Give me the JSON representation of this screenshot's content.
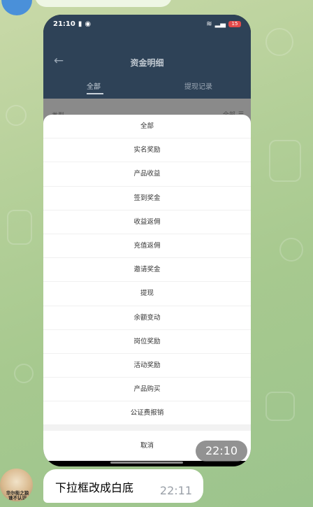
{
  "phone": {
    "status": {
      "time": "21:10",
      "battery": "15"
    },
    "header": {
      "title": "资金明细",
      "back_icon": "arrow-left-icon"
    },
    "tabs": [
      "全部",
      "提现记录"
    ],
    "filter": {
      "label": "类型",
      "value": "全部",
      "icon": "list-icon"
    },
    "options": [
      "全部",
      "实名奖励",
      "产品收益",
      "签到奖金",
      "收益返佣",
      "充值返佣",
      "邀请奖金",
      "提现",
      "余额变动",
      "岗位奖励",
      "活动奖励",
      "产品购买",
      "公证费报销"
    ],
    "cancel": "取消"
  },
  "image_time": "22:10",
  "avatar_caption": "华尔街之狼\n谁不认识",
  "message": {
    "text": "下拉框改成白底",
    "time": "22:11"
  }
}
